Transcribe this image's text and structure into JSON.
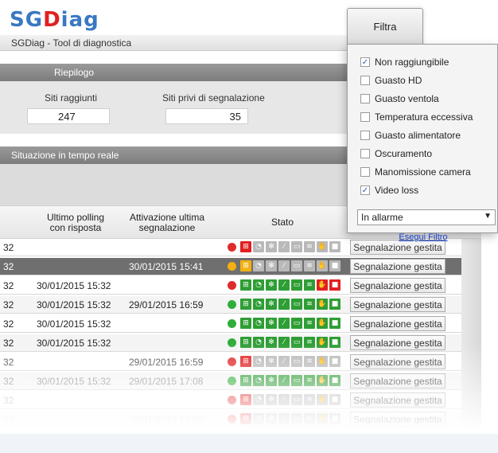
{
  "app": {
    "logo_sg": "SG",
    "logo_d": "D",
    "logo_iag": "iag",
    "subtitle": "SGDiag - Tool di diagnostica"
  },
  "riepilogo": {
    "title": "Riepilogo",
    "siti_raggiunti_label": "Siti raggiunti",
    "siti_raggiunti_value": "247",
    "siti_privi_label": "Siti privi di segnalazione",
    "siti_privi_value": "35"
  },
  "situazione": {
    "title": "Situazione in tempo reale"
  },
  "grid": {
    "col_ultimo": [
      "Ultimo polling",
      "con risposta"
    ],
    "col_attivazione": [
      "Attivazione ultima",
      "segnalazione"
    ],
    "col_stato": "Stato",
    "button_label": "Segnalazione gestita",
    "rows": [
      {
        "c0": "32",
        "polling": "",
        "attivazione": "",
        "dot": "#e02b2b",
        "state": "partial",
        "bg": "#ffffff",
        "color": "#222"
      },
      {
        "c0": "32",
        "polling": "",
        "attivazione": "30/01/2015 15:41",
        "dot": "#f2b111",
        "state": "warn",
        "bg": "#6f6f6f",
        "color": "#ffffff"
      },
      {
        "c0": "32",
        "polling": "30/01/2015 15:32",
        "attivazione": "",
        "dot": "#e02b2b",
        "state": "alarm",
        "bg": "#ffffff",
        "color": "#222"
      },
      {
        "c0": "32",
        "polling": "30/01/2015 15:32",
        "attivazione": "29/01/2015 16:59",
        "dot": "#2fae3a",
        "state": "ok",
        "bg": "#f4f4f4",
        "color": "#222"
      },
      {
        "c0": "32",
        "polling": "30/01/2015 15:32",
        "attivazione": "",
        "dot": "#2fae3a",
        "state": "ok",
        "bg": "#ffffff",
        "color": "#222"
      },
      {
        "c0": "32",
        "polling": "30/01/2015 15:32",
        "attivazione": "",
        "dot": "#2fae3a",
        "state": "ok",
        "bg": "#f4f4f4",
        "color": "#222"
      },
      {
        "c0": "32",
        "polling": "",
        "attivazione": "29/01/2015 16:59",
        "dot": "#e02b2b",
        "state": "red",
        "bg": "#ffffff",
        "color": "#444"
      },
      {
        "c0": "32",
        "polling": "30/01/2015 15:32",
        "attivazione": "29/01/2015 17:08",
        "dot": "#2fae3a",
        "state": "ok",
        "bg": "#f4f4f4",
        "color": "#888"
      },
      {
        "c0": "32",
        "polling": "",
        "attivazione": "",
        "dot": "#e02b2b",
        "state": "red",
        "bg": "#ffffff",
        "color": "#aaa"
      },
      {
        "c0": "32",
        "polling": "",
        "attivazione": "29/01/2015 15:59",
        "dot": "#e02b2b",
        "state": "red",
        "bg": "#f4f4f4",
        "color": "#ccc"
      }
    ]
  },
  "filter": {
    "button_label": "Filtra",
    "items": [
      {
        "label": "Non raggiungibile",
        "checked": true
      },
      {
        "label": "Guasto HD",
        "checked": false
      },
      {
        "label": "Guasto ventola",
        "checked": false
      },
      {
        "label": "Temperatura eccessiva",
        "checked": false
      },
      {
        "label": "Guasto alimentatore",
        "checked": false
      },
      {
        "label": "Oscuramento",
        "checked": false
      },
      {
        "label": "Manomissione camera",
        "checked": false
      },
      {
        "label": "Video loss",
        "checked": true
      }
    ],
    "select_value": "In allarme",
    "link_label": "Esegui Filtro"
  },
  "icons": [
    "network-icon",
    "disk-icon",
    "fan-icon",
    "temperature-icon",
    "power-icon",
    "obscured-icon",
    "tamper-icon",
    "video-icon"
  ],
  "colors": {
    "ok": "#2e9e35",
    "alarm": "#e02020",
    "warn": "#f2b111",
    "grey": "#b9b9b9"
  }
}
